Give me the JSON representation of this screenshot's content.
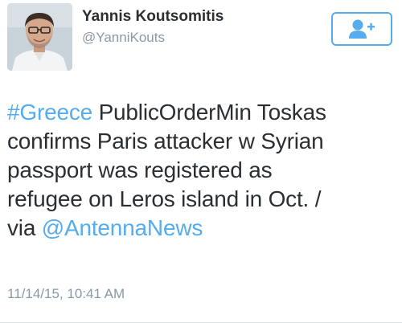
{
  "author": {
    "display_name": "Yannis Koutsomitis",
    "handle": "@YanniKouts"
  },
  "follow_button": {
    "icon": "add-user-icon",
    "color": "#55acee"
  },
  "tweet": {
    "hashtag": "#Greece",
    "line1_rest": " PublicOrderMin Toskas",
    "line2": "confirms Paris attacker w Syrian",
    "line3": "passport was registered as",
    "line4": "refugee on Leros island in Oct. /",
    "line5_prefix": "via ",
    "mention": "@AntennaNews"
  },
  "timestamp": "11/14/15, 10:41 AM",
  "colors": {
    "link": "#55acee",
    "text": "#292f33",
    "muted": "#8899a6"
  }
}
